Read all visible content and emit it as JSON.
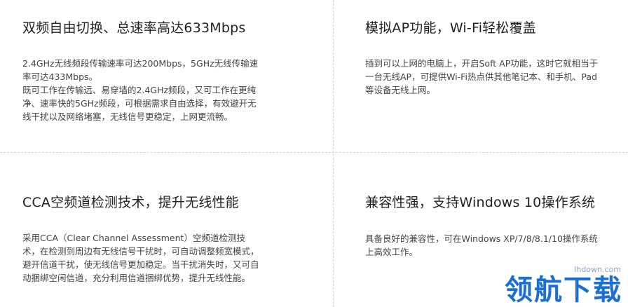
{
  "features": [
    {
      "title": "双频自由切换、总速率高达633Mbps",
      "paragraphs": [
        "2.4GHz无线频段传输速率可达200Mbps，5GHz无线传输速率可达433Mbps。",
        "既可工作在传输远、易穿墙的2.4GHz频段，又可工作在更纯净、速率快的5GHz频段，可根据需求自由选择，有效避开无线干扰以及网络堵塞，无线信号更稳定，上网更流畅。"
      ]
    },
    {
      "title": "模拟AP功能，Wi-Fi轻松覆盖",
      "paragraphs": [
        "插到可以上网的电脑上，开启Soft AP功能，这时它就相当于一台无线AP，可提供Wi-Fi热点供其他笔记本、和手机、Pad等设备无线上网。"
      ]
    },
    {
      "title": "CCA空频道检测技术，提升无线性能",
      "paragraphs": [
        "采用CCA（Clear Channel Assessment）空频道检测技术，在检测到周边有无线信号干扰时，可自动调整频宽模式，避开信道干扰，使无线信号更加稳定。当干扰消失时，又可自动捆绑空闲信道，充分利用信道捆绑优势，提升无线性能。"
      ]
    },
    {
      "title": "兼容性强，支持Windows 10操作系统",
      "paragraphs": [
        "具备良好的兼容性，可在Windows XP/7/8/8.1/10操作系统上高效工作。"
      ]
    }
  ],
  "watermark": {
    "url": "lhdown.com",
    "text": "领航下载"
  }
}
